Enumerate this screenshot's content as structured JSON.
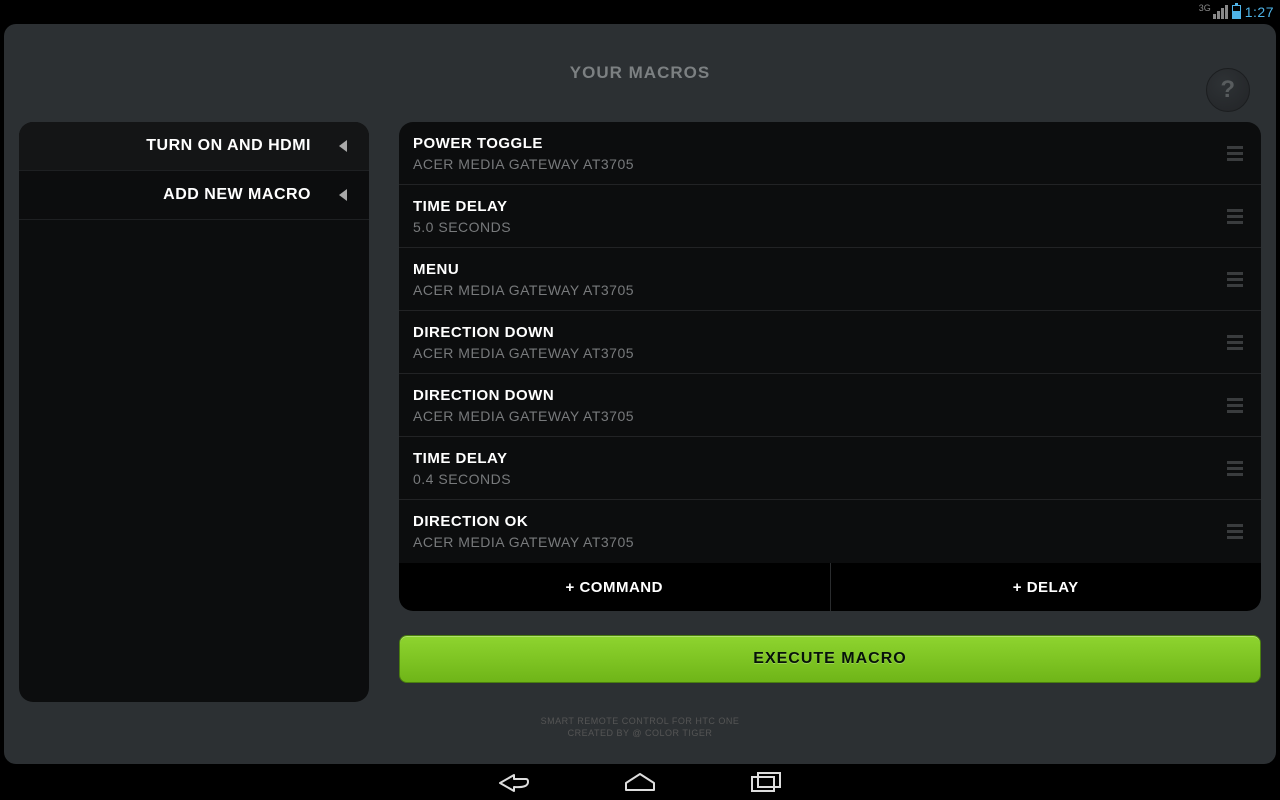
{
  "status": {
    "network": "3G",
    "time": "1:27"
  },
  "header": {
    "title": "YOUR MACROS"
  },
  "sidebar": {
    "items": [
      {
        "label": "TURN ON AND HDMI"
      },
      {
        "label": "ADD NEW MACRO"
      }
    ]
  },
  "steps": [
    {
      "title": "POWER TOGGLE",
      "sub": "ACER MEDIA GATEWAY AT3705"
    },
    {
      "title": "TIME DELAY",
      "sub": "5.0 SECONDS"
    },
    {
      "title": "MENU",
      "sub": "ACER MEDIA GATEWAY AT3705"
    },
    {
      "title": "DIRECTION DOWN",
      "sub": "ACER MEDIA GATEWAY AT3705"
    },
    {
      "title": "DIRECTION DOWN",
      "sub": "ACER MEDIA GATEWAY AT3705"
    },
    {
      "title": "TIME DELAY",
      "sub": "0.4 SECONDS"
    },
    {
      "title": "DIRECTION OK",
      "sub": "ACER MEDIA GATEWAY AT3705"
    }
  ],
  "buttons": {
    "add_command": "+ COMMAND",
    "add_delay": "+ DELAY",
    "execute": "EXECUTE MACRO"
  },
  "footer": {
    "line1": "SMART REMOTE CONTROL FOR HTC ONE",
    "line2": "CREATED BY @ COLOR TIGER"
  },
  "help": "?"
}
